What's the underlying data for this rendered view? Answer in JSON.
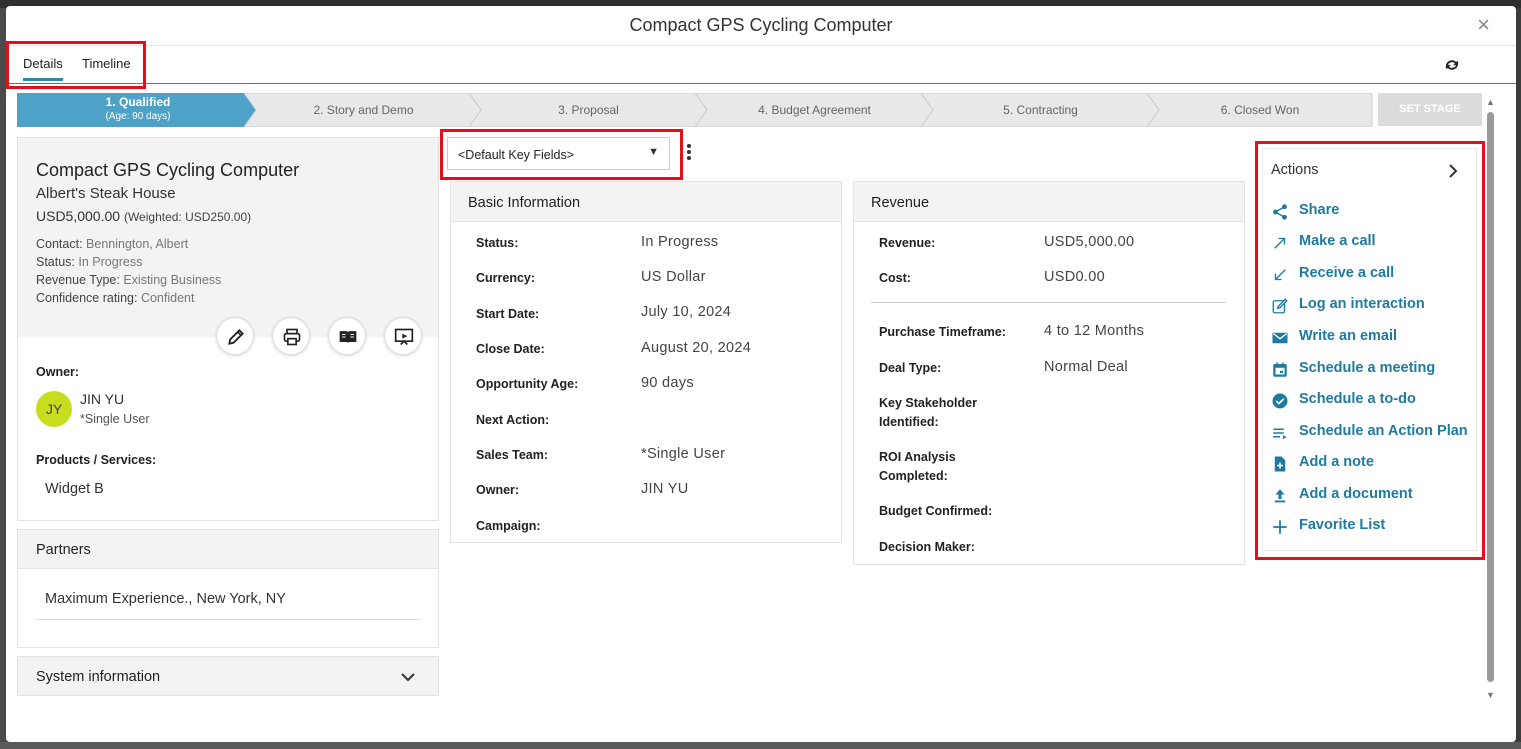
{
  "modal": {
    "title": "Compact GPS Cycling Computer",
    "close_glyph": "×"
  },
  "tabs": [
    {
      "label": "Details"
    },
    {
      "label": "Timeline"
    }
  ],
  "stages": [
    {
      "label": "1. Qualified",
      "sub": "(Age: 90 days)",
      "active": true
    },
    {
      "label": "2. Story and Demo"
    },
    {
      "label": "3. Proposal"
    },
    {
      "label": "4. Budget Agreement"
    },
    {
      "label": "5. Contracting"
    },
    {
      "label": "6. Closed Won"
    }
  ],
  "set_stage_label": "SET STAGE",
  "summary": {
    "title": "Compact GPS Cycling Computer",
    "account": "Albert's Steak House",
    "amount": "USD5,000.00",
    "weighted": "(Weighted: USD250.00)",
    "lines": [
      {
        "label": "Contact:",
        "value": "Bennington, Albert"
      },
      {
        "label": "Status:",
        "value": "In Progress"
      },
      {
        "label": "Revenue Type:",
        "value": "Existing Business"
      },
      {
        "label": "Confidence rating:",
        "value": "Confident"
      }
    ],
    "owner_label": "Owner:",
    "owner_initials": "JY",
    "owner_name": "JIN YU",
    "owner_sub": "*Single User",
    "products_label": "Products / Services:",
    "product": "Widget B"
  },
  "partners": {
    "title": "Partners",
    "line": "Maximum Experience., New York, NY"
  },
  "system_info": {
    "title": "System information"
  },
  "key_fields": {
    "selected": "<Default Key Fields>"
  },
  "basic_info": {
    "title": "Basic Information",
    "fields": [
      {
        "label": "Status:",
        "value": "In Progress"
      },
      {
        "label": "Currency:",
        "value": "US Dollar"
      },
      {
        "label": "Start Date:",
        "value": "July 10, 2024"
      },
      {
        "label": "Close Date:",
        "value": "August 20, 2024"
      },
      {
        "label": "Opportunity Age:",
        "value": "90 days"
      },
      {
        "label": "Next Action:",
        "value": ""
      },
      {
        "label": "Sales Team:",
        "value": "*Single User"
      },
      {
        "label": "Owner:",
        "value": "JIN YU"
      },
      {
        "label": "Campaign:",
        "value": ""
      }
    ]
  },
  "revenue": {
    "title": "Revenue",
    "fields": [
      {
        "label": "Revenue:",
        "value": "USD5,000.00"
      },
      {
        "label": "Cost:",
        "value": "USD0.00"
      },
      {
        "label": "Purchase Timeframe:",
        "value": "4 to 12 Months"
      },
      {
        "label": "Deal Type:",
        "value": "Normal Deal"
      },
      {
        "label": "Key Stakeholder",
        "label2": "Identified:",
        "value": ""
      },
      {
        "label": "ROI Analysis",
        "label2": "Completed:",
        "value": ""
      },
      {
        "label": "Budget Confirmed:",
        "value": ""
      },
      {
        "label": "Decision Maker:",
        "value": ""
      }
    ]
  },
  "actions": {
    "title": "Actions",
    "items": [
      {
        "label": "Share",
        "icon": "share-icon"
      },
      {
        "label": "Make a call",
        "icon": "outgoing-call-icon"
      },
      {
        "label": "Receive a call",
        "icon": "incoming-call-icon"
      },
      {
        "label": "Log an interaction",
        "icon": "edit-note-icon"
      },
      {
        "label": "Write an email",
        "icon": "email-icon"
      },
      {
        "label": "Schedule a meeting",
        "icon": "calendar-icon"
      },
      {
        "label": "Schedule a to-do",
        "icon": "check-circle-icon"
      },
      {
        "label": "Schedule an Action Plan",
        "icon": "list-icon"
      },
      {
        "label": "Add a note",
        "icon": "note-icon"
      },
      {
        "label": "Add a document",
        "icon": "upload-icon"
      },
      {
        "label": "Favorite List",
        "icon": "plus-icon"
      }
    ]
  },
  "colors": {
    "accent": "#1f7aa2",
    "active_stage": "#4ea2c7",
    "highlight": "#e0101d",
    "avatar": "#c9dd1f"
  }
}
